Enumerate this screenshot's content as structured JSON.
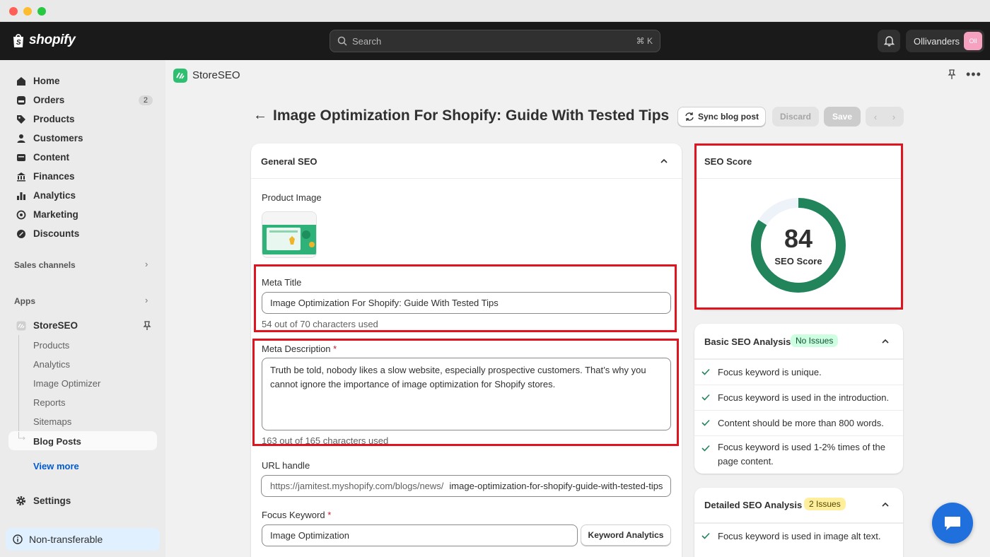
{
  "topbar": {
    "brand": "shopify",
    "search_placeholder": "Search",
    "search_shortcut": "⌘ K",
    "store_name": "Ollivanders",
    "avatar_initials": "Oll"
  },
  "sidebar": {
    "items": [
      {
        "label": "Home",
        "icon": "home-icon"
      },
      {
        "label": "Orders",
        "icon": "orders-icon",
        "badge": "2"
      },
      {
        "label": "Products",
        "icon": "tag-icon"
      },
      {
        "label": "Customers",
        "icon": "person-icon"
      },
      {
        "label": "Content",
        "icon": "content-icon"
      },
      {
        "label": "Finances",
        "icon": "bank-icon"
      },
      {
        "label": "Analytics",
        "icon": "bar-chart-icon"
      },
      {
        "label": "Marketing",
        "icon": "target-icon"
      },
      {
        "label": "Discounts",
        "icon": "discount-icon"
      }
    ],
    "sales_channels": "Sales channels",
    "apps": "Apps",
    "app_name": "StoreSEO",
    "app_subitems": [
      "Products",
      "Analytics",
      "Image Optimizer",
      "Reports",
      "Sitemaps",
      "Blog Posts"
    ],
    "view_more": "View more",
    "settings": "Settings",
    "non_transferable": "Non-transferable"
  },
  "app_header": {
    "name": "StoreSEO"
  },
  "page": {
    "title": "Image Optimization For Shopify: Guide With Tested Tips",
    "sync_label": "Sync blog post",
    "discard_label": "Discard",
    "save_label": "Save"
  },
  "general_seo": {
    "title": "General SEO",
    "product_image_label": "Product Image",
    "meta_title_label": "Meta Title",
    "meta_title_value": "Image Optimization For Shopify: Guide With Tested Tips",
    "meta_title_helper": "54 out of 70 characters used",
    "meta_desc_label": "Meta Description",
    "meta_desc_required": "*",
    "meta_desc_value": "Truth be told, nobody likes a slow website, especially prospective customers. That’s why you cannot ignore the importance of image optimization for Shopify stores.",
    "meta_desc_helper": "163 out of 165 characters used",
    "url_label": "URL handle",
    "url_prefix": "https://jamitest.myshopify.com/blogs/news/",
    "url_value": "image-optimization-for-shopify-guide-with-tested-tips",
    "focus_label": "Focus Keyword",
    "focus_required": "*",
    "focus_value": "Image Optimization",
    "keyword_btn": "Keyword Analytics"
  },
  "seo_score": {
    "title": "SEO Score",
    "score": "84",
    "score_fraction": 0.84,
    "label": "SEO Score",
    "color": "#21845b"
  },
  "basic_analysis": {
    "title": "Basic SEO Analysis",
    "badge": "No Issues",
    "checks": [
      "Focus keyword is unique.",
      "Focus keyword is used in the introduction.",
      "Content should be more than 800 words.",
      "Focus keyword is used 1-2% times of the page content."
    ]
  },
  "detailed_analysis": {
    "title": "Detailed SEO Analysis",
    "badge": "2 Issues",
    "checks": [
      "Focus keyword is used in image alt text."
    ]
  }
}
